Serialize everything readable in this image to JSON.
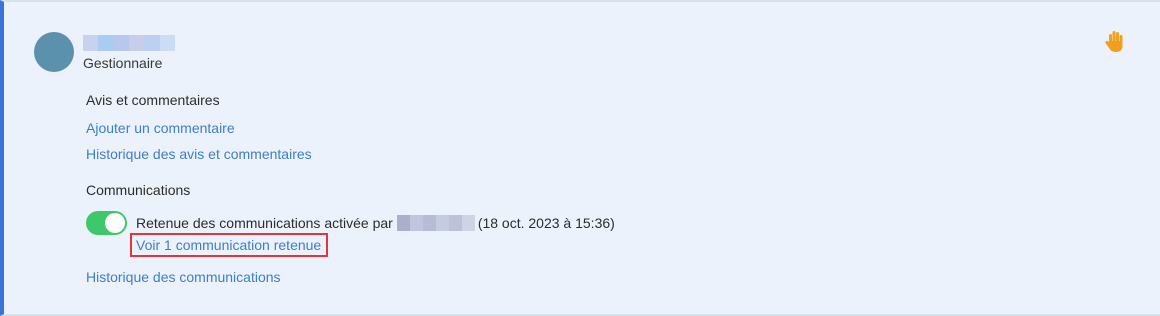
{
  "user": {
    "role": "Gestionnaire",
    "name_blur_colors": [
      "#c7d2ee",
      "#a9cdf2",
      "#b8c7ec",
      "#c8cdea",
      "#bcd0f0",
      "#cbdcf4"
    ]
  },
  "status_icon": "raised-hand-icon",
  "reviews": {
    "title": "Avis et commentaires",
    "add_comment_link": "Ajouter un commentaire",
    "history_link": "Historique des avis et commentaires"
  },
  "communications": {
    "title": "Communications",
    "hold_toggle_on": true,
    "hold_text_prefix": "Retenue des communications activée par",
    "hold_user_blur_colors": [
      "#aab0cc",
      "#c2c6dd",
      "#b7bcd6",
      "#c6cce0",
      "#bcc2d8",
      "#cfd3e5"
    ],
    "hold_timestamp": "(18 oct. 2023 à 15:36)",
    "view_held_link": "Voir 1 communication retenue",
    "history_link": "Historique des communications"
  },
  "colors": {
    "accent_border": "#3b73d8",
    "link": "#3d7fc4",
    "toggle_on": "#3ec86b",
    "highlight": "#e0363c",
    "hand": "#f0a020"
  }
}
